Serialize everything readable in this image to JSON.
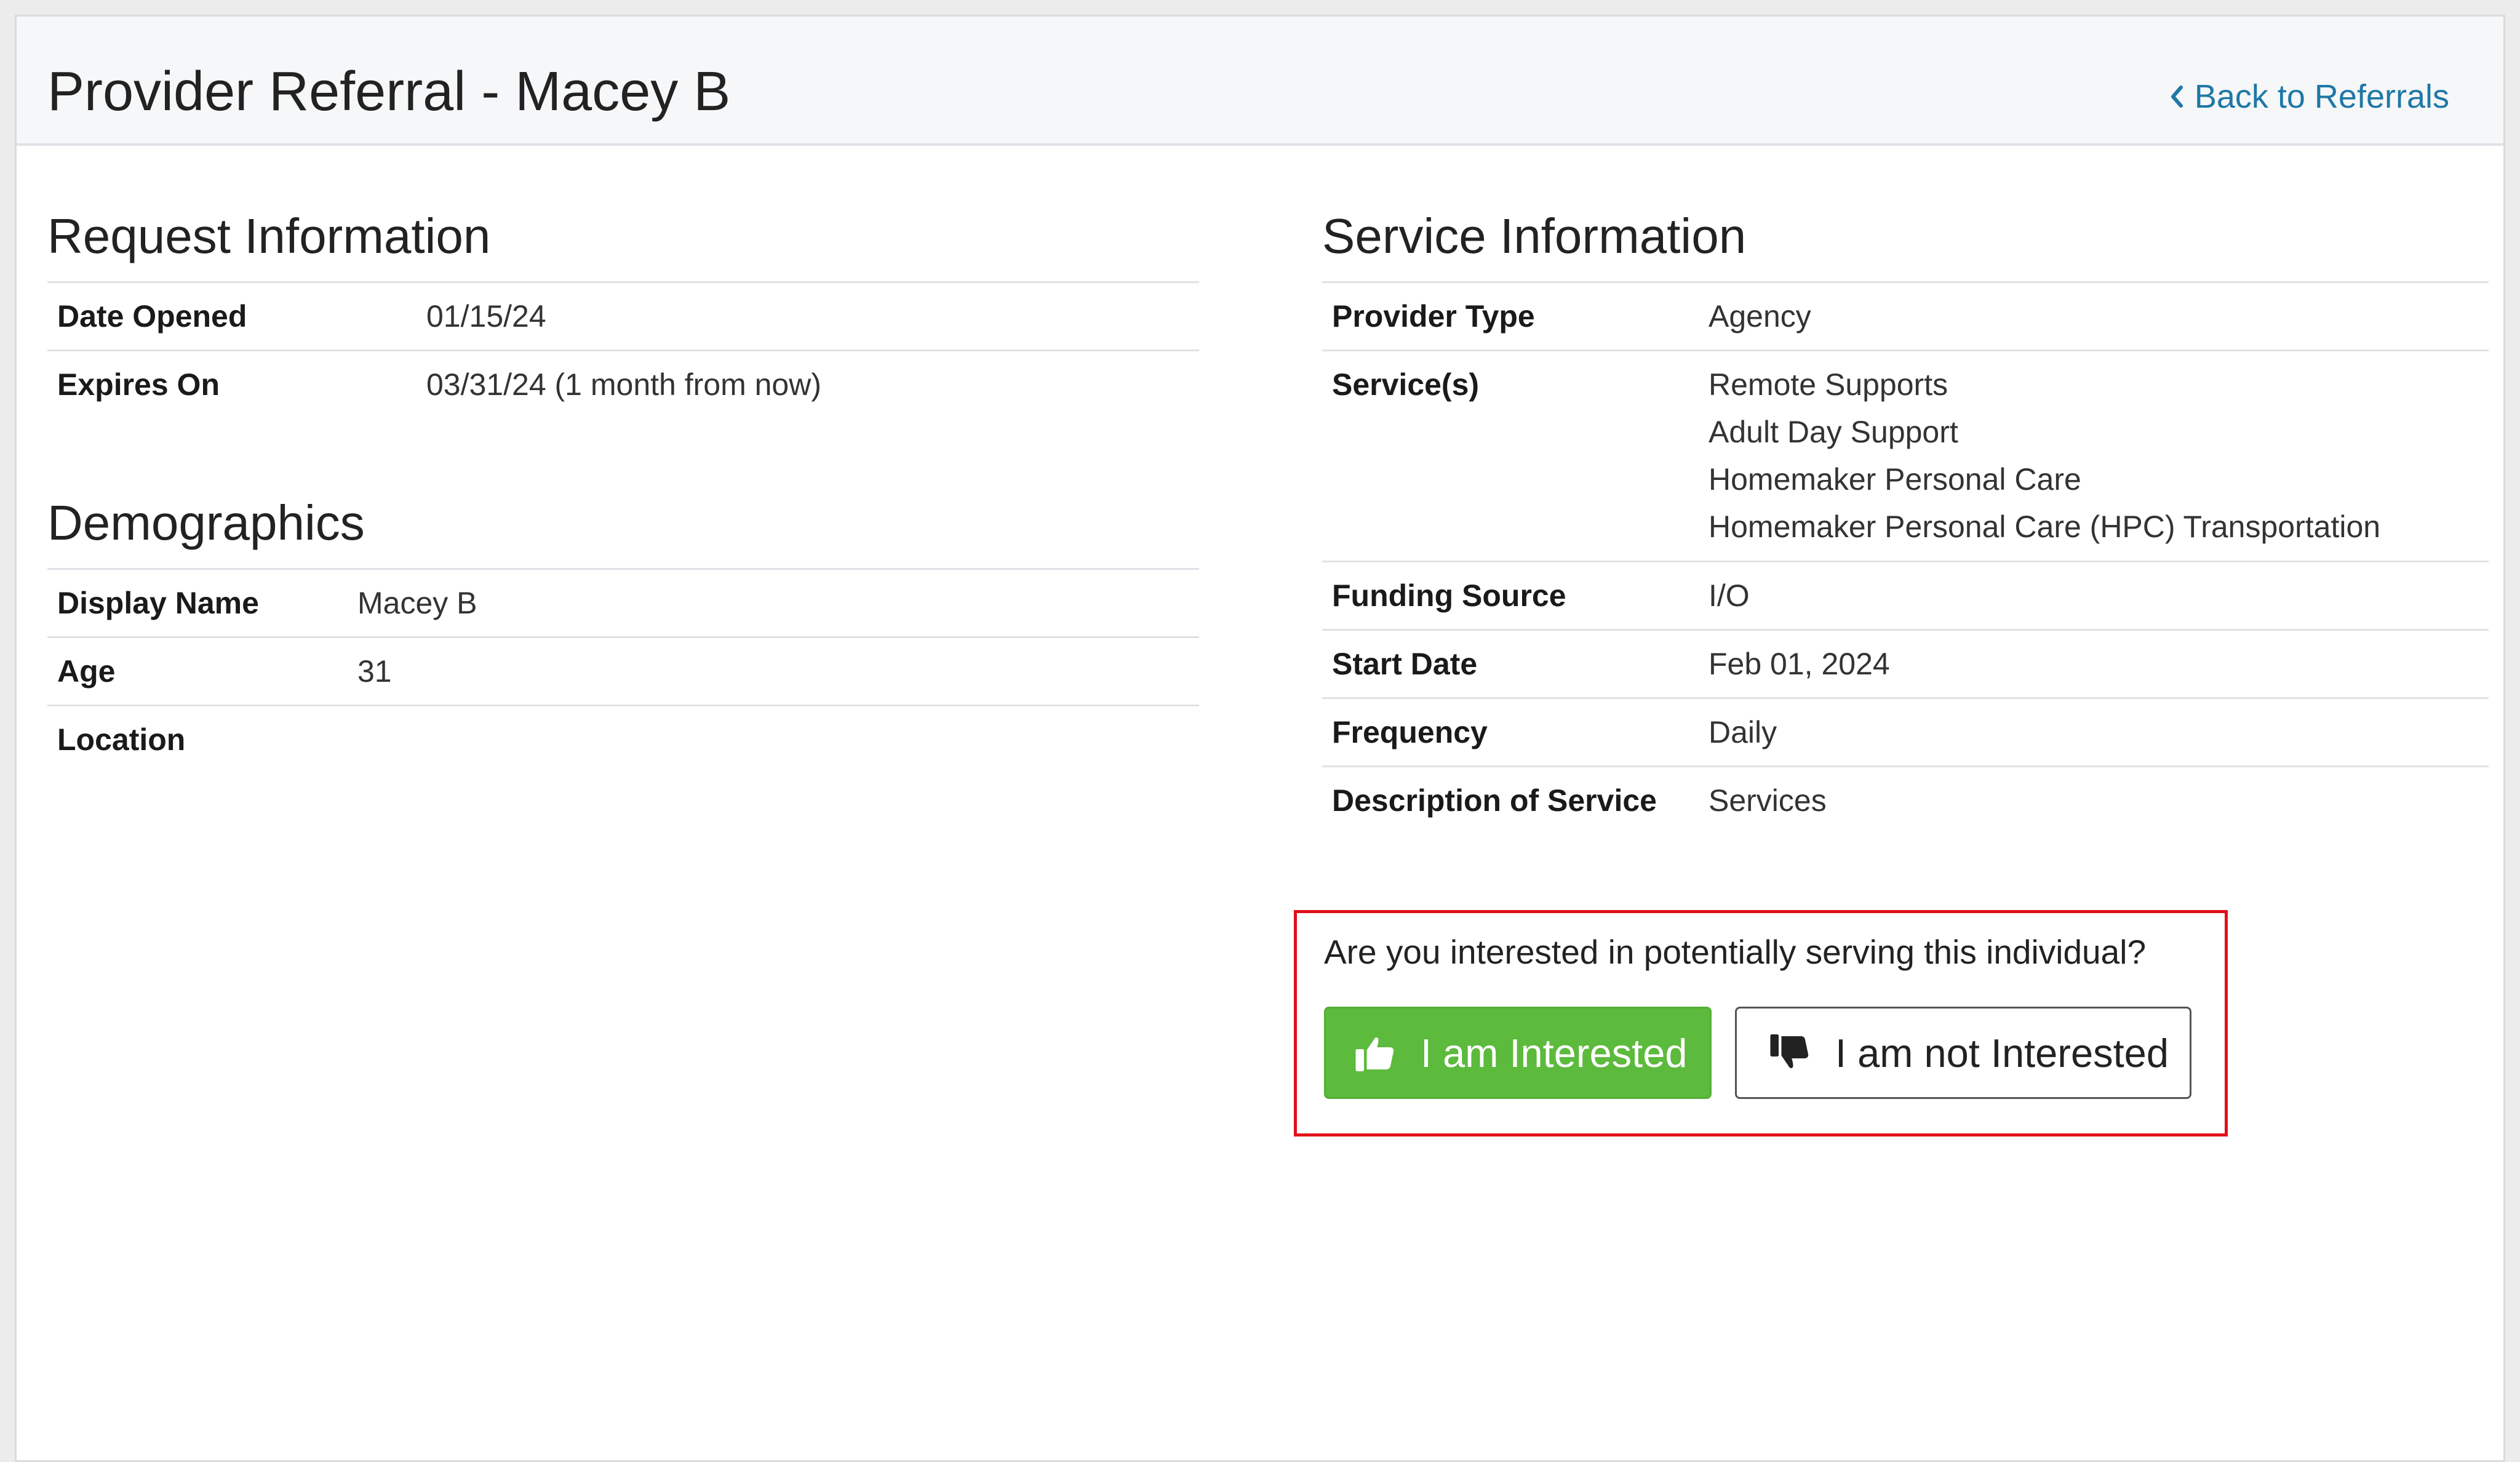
{
  "header": {
    "title": "Provider Referral - Macey B",
    "back_link": "Back to Referrals"
  },
  "request_information": {
    "title": "Request Information",
    "rows": [
      {
        "label": "Date Opened",
        "value": "01/15/24"
      },
      {
        "label": "Expires On",
        "value": "03/31/24 (1 month from now)"
      }
    ]
  },
  "demographics": {
    "title": "Demographics",
    "rows": [
      {
        "label": "Display Name",
        "value": "Macey B"
      },
      {
        "label": "Age",
        "value": "31"
      },
      {
        "label": "Location",
        "value": ""
      }
    ]
  },
  "service_information": {
    "title": "Service Information",
    "provider_type": {
      "label": "Provider Type",
      "value": "Agency"
    },
    "services": {
      "label": "Service(s)",
      "values": [
        "Remote Supports",
        "Adult Day Support",
        "Homemaker Personal Care",
        "Homemaker Personal Care (HPC) Transportation"
      ]
    },
    "funding_source": {
      "label": "Funding Source",
      "value": "I/O"
    },
    "start_date": {
      "label": "Start Date",
      "value": "Feb 01, 2024"
    },
    "frequency": {
      "label": "Frequency",
      "value": "Daily"
    },
    "description": {
      "label": "Description of Service",
      "value": "Services"
    }
  },
  "interest": {
    "question": "Are you interested in potentially serving this individual?",
    "interested_label": "I am Interested",
    "not_interested_label": "I am not Interested"
  },
  "colors": {
    "link": "#1f78a6",
    "interested_button": "#5cba3c",
    "callout_border": "#e0111b"
  },
  "icons": {
    "back": "chevron-left-icon",
    "interested": "thumbs-up-icon",
    "not_interested": "thumbs-down-icon"
  }
}
